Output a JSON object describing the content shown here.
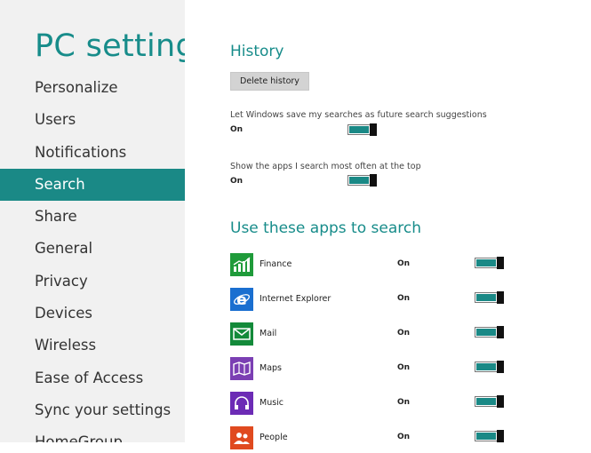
{
  "sidebar": {
    "title": "PC settings",
    "items": [
      {
        "label": "Personalize"
      },
      {
        "label": "Users"
      },
      {
        "label": "Notifications"
      },
      {
        "label": "Search",
        "active": true
      },
      {
        "label": "Share"
      },
      {
        "label": "General"
      },
      {
        "label": "Privacy"
      },
      {
        "label": "Devices"
      },
      {
        "label": "Wireless"
      },
      {
        "label": "Ease of Access"
      },
      {
        "label": "Sync your settings"
      },
      {
        "label": "HomeGroup"
      }
    ]
  },
  "history": {
    "title": "History",
    "delete_button": "Delete history",
    "settings": [
      {
        "label": "Let Windows save my searches as future search suggestions",
        "state": "On"
      },
      {
        "label": "Show the apps I search most often at the top",
        "state": "On"
      }
    ]
  },
  "apps_section": {
    "title": "Use these apps to search",
    "apps": [
      {
        "name": "Finance",
        "state": "On",
        "icon": "finance-icon",
        "color": "#1f9b3a"
      },
      {
        "name": "Internet Explorer",
        "state": "On",
        "icon": "internet-explorer-icon",
        "color": "#1a6fd0"
      },
      {
        "name": "Mail",
        "state": "On",
        "icon": "mail-icon",
        "color": "#138a3a"
      },
      {
        "name": "Maps",
        "state": "On",
        "icon": "maps-icon",
        "color": "#7b3fb3"
      },
      {
        "name": "Music",
        "state": "On",
        "icon": "music-icon",
        "color": "#6c2bb5"
      },
      {
        "name": "People",
        "state": "On",
        "icon": "people-icon",
        "color": "#e04a1f"
      }
    ]
  },
  "colors": {
    "accent": "#1a8986",
    "sidebar_bg": "#f1f1f1"
  }
}
